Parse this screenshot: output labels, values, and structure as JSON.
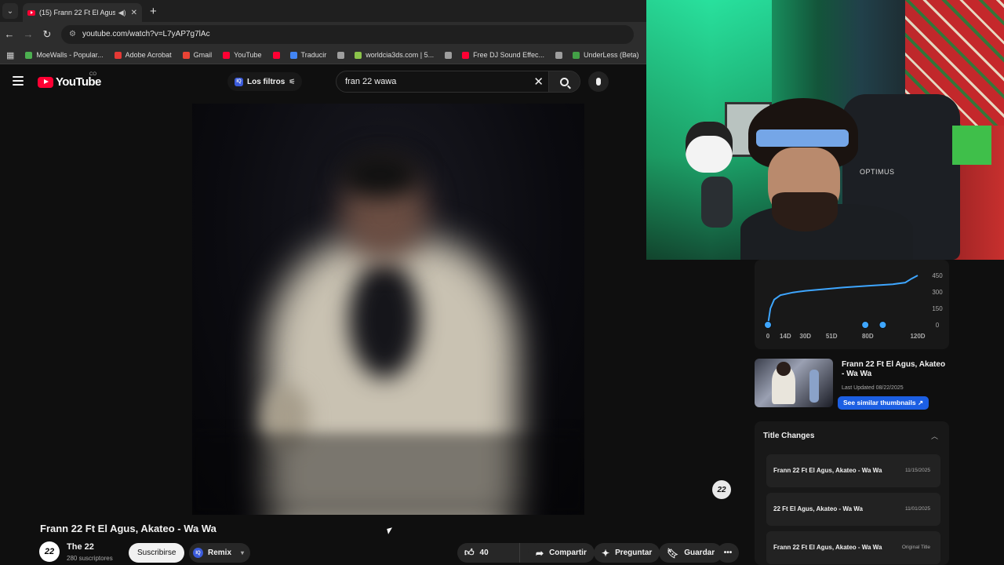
{
  "browser": {
    "tab_title": "(15) Frann 22 Ft El Agus, Akateo - Wa Wa",
    "url": "youtube.com/watch?v=L7yAP7g7lAc",
    "bookmarks": [
      {
        "label": "MoeWalls - Popular...",
        "color": "#4caf50"
      },
      {
        "label": "Adobe Acrobat",
        "color": "#e53935"
      },
      {
        "label": "Gmail",
        "color": "#ea4335"
      },
      {
        "label": "YouTube",
        "color": "#ff0033"
      },
      {
        "label": "",
        "color": "#ff0033"
      },
      {
        "label": "Traducir",
        "color": "#4285f4"
      },
      {
        "label": "",
        "color": "#9e9e9e"
      },
      {
        "label": "worldcia3ds.com | 5...",
        "color": "#8bc34a"
      },
      {
        "label": "",
        "color": "#9e9e9e"
      },
      {
        "label": "Free DJ Sound Effec...",
        "color": "#ff0033"
      },
      {
        "label": "",
        "color": "#9e9e9e"
      },
      {
        "label": "UnderLess (Beta)",
        "color": "#43a047"
      }
    ]
  },
  "header": {
    "logo": "YouTube",
    "logo_country": "CO",
    "filters_label": "Los filtros",
    "search_value": "fran 22 wawa"
  },
  "video": {
    "title": "Frann 22 Ft El Agus, Akateo - Wa Wa",
    "channel": "The 22",
    "subscribers": "280 suscriptores",
    "subscribe_label": "Suscribirse",
    "remix_label": "Remix",
    "likes": "40",
    "share_label": "Compartir",
    "ask_label": "Preguntar",
    "save_label": "Guardar",
    "avatar_text": "22"
  },
  "chart_data": {
    "type": "line",
    "title": "",
    "x_tick_labels": [
      "0",
      "14D",
      "30D",
      "51D",
      "80D",
      "120D"
    ],
    "y_tick_labels": [
      "450",
      "300",
      "150",
      "0"
    ],
    "ylim": [
      0,
      450
    ],
    "xlim": [
      0,
      120
    ],
    "series": [
      {
        "values": [
          [
            0,
            0
          ],
          [
            2,
            150
          ],
          [
            5,
            230
          ],
          [
            10,
            270
          ],
          [
            20,
            295
          ],
          [
            30,
            310
          ],
          [
            45,
            325
          ],
          [
            60,
            340
          ],
          [
            80,
            355
          ],
          [
            100,
            370
          ],
          [
            110,
            385
          ],
          [
            115,
            420
          ],
          [
            120,
            450
          ]
        ]
      }
    ],
    "markers_x": [
      0,
      78,
      92
    ],
    "line_color": "#3ea6ff"
  },
  "thumbnail_card": {
    "title": "Frann 22 Ft El Agus, Akateo - Wa Wa",
    "last_updated": "Last Updated 08/22/2025",
    "similar_label": "See similar thumbnails ↗"
  },
  "title_changes": {
    "heading": "Title Changes",
    "rows": [
      {
        "title": "Frann 22 Ft El Agus, Akateo - Wa Wa",
        "date": "11/15/2025"
      },
      {
        "title": "22 Ft El Agus, Akateo - Wa Wa",
        "date": "11/01/2025"
      },
      {
        "title": "Frann 22 Ft El Agus, Akateo - Wa Wa",
        "date": "Original Title"
      }
    ]
  },
  "webcam": {
    "chair_text": "OPTIMUS"
  },
  "channel_badge": "22"
}
